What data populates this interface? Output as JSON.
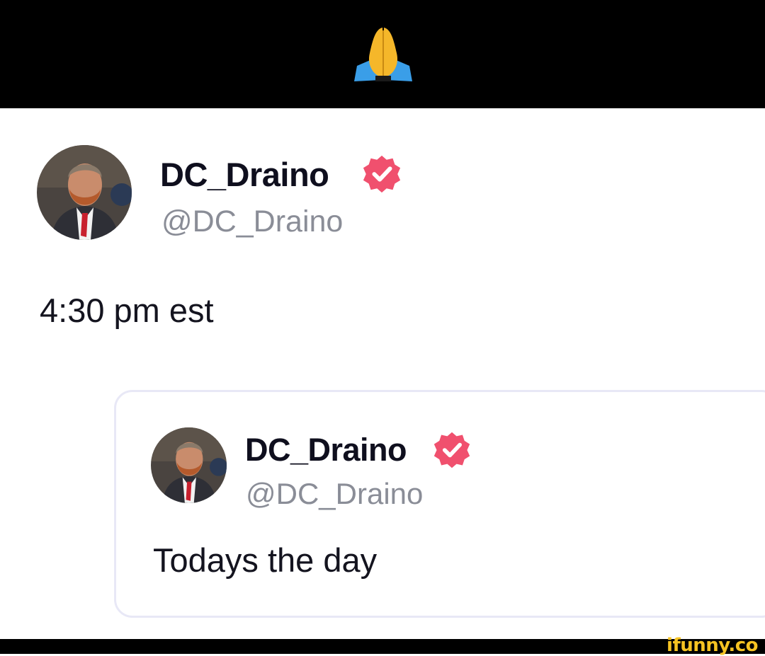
{
  "header": {
    "emoji": "🙏",
    "emoji_icon": "folded-hands-icon"
  },
  "post": {
    "author": {
      "display_name": "DC_Draino",
      "handle": "@DC_Draino",
      "verified": true,
      "badge_color": "#f0506e"
    },
    "text": "4:30 pm est"
  },
  "quoted_post": {
    "author": {
      "display_name": "DC_Draino",
      "handle": "@DC_Draino",
      "verified": true,
      "badge_color": "#f0506e"
    },
    "text": "Todays the day"
  },
  "watermark": "ifunny.co"
}
